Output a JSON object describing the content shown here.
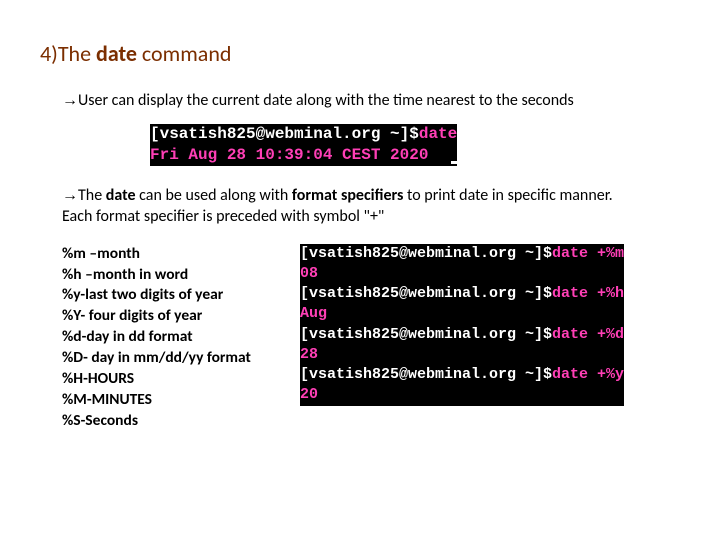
{
  "heading": {
    "num": "4)",
    "pre": "The ",
    "cmd": "date",
    "post": " command"
  },
  "p1": {
    "arrow": "→",
    "text": "User can display the current date along with the time nearest to the seconds"
  },
  "term1": {
    "l1a": "[vsatish825@webminal.org ~]$",
    "l1b": "date",
    "l2": "Fri Aug 28 10:39:04 CEST 2020"
  },
  "p2": {
    "arrow": "→",
    "a": "The ",
    "b": "date ",
    "c": "can be used along with ",
    "d": "format specifiers  ",
    "e": "to print date in specific manner."
  },
  "p2sub": "Each format specifier is preceded with  symbol  \"+\"",
  "specs": {
    "l1": "%m –month",
    "l2": "%h –month in word",
    "l3": "%y-last two digits of year",
    "l4": "%Y- four digits of year",
    "l5": "%d-day in dd format",
    "l6": "%D- day in mm/dd/yy format",
    "l7": "%H-HOURS",
    "l8": "%M-MINUTES",
    "l9": "%S-Seconds"
  },
  "term2": {
    "p": "[vsatish825@webminal.org ~]$",
    "c1": "date +%m",
    "o1": "08",
    "c2": "date +%h",
    "o2": "Aug",
    "c3": "date +%d",
    "o3": "28",
    "c4": "date +%y",
    "o4": "20"
  }
}
